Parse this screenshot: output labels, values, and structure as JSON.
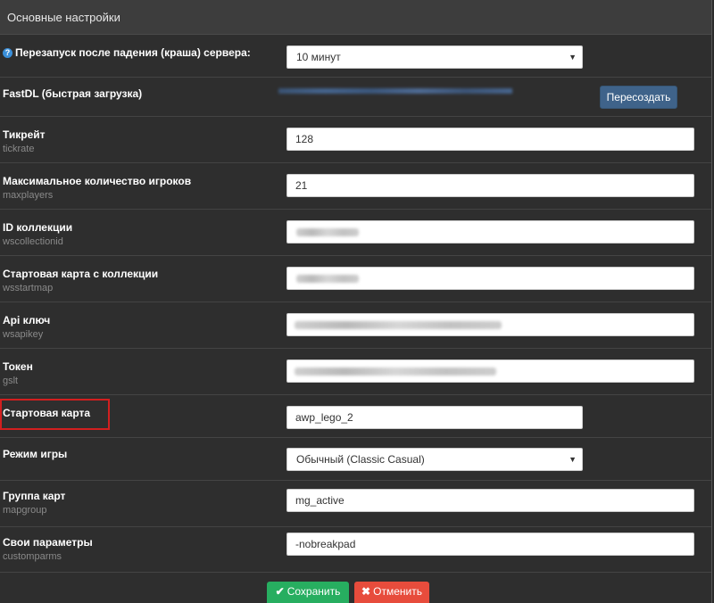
{
  "panel": {
    "title": "Основные настройки"
  },
  "settings": {
    "restart": {
      "label": "Перезапуск после падения (краша) сервера:",
      "value": "10 минут"
    },
    "fastdl": {
      "label": "FastDL (быстрая загрузка)",
      "button": "Пересоздать"
    },
    "tickrate": {
      "label": "Тикрейт",
      "sub": "tickrate",
      "value": "128"
    },
    "maxplayers": {
      "label": "Максимальное количество игроков",
      "sub": "maxplayers",
      "value": "21"
    },
    "collection": {
      "label": "ID коллекции",
      "sub": "wscollectionid"
    },
    "startmap_ws": {
      "label": "Стартовая карта с коллекции",
      "sub": "wsstartmap"
    },
    "apikey": {
      "label": "Api ключ",
      "sub": "wsapikey"
    },
    "token": {
      "label": "Токен",
      "sub": "gslt"
    },
    "startmap": {
      "label": "Стартовая карта",
      "value": "awp_lego_2"
    },
    "gamemode": {
      "label": "Режим игры",
      "value": "Обычный (Classic Casual)"
    },
    "mapgroup": {
      "label": "Группа карт",
      "sub": "mapgroup",
      "value": "mg_active"
    },
    "customparms": {
      "label": "Свои параметры",
      "sub": "customparms",
      "value": "-nobreakpad"
    }
  },
  "actions": {
    "save": "Сохранить",
    "cancel": "Отменить"
  },
  "icons": {
    "help": "question-circle-icon",
    "caret": "caret-down-icon",
    "save": "check-icon",
    "cancel": "times-icon"
  },
  "colors": {
    "save": "#27ae60",
    "cancel": "#e74c3c",
    "recreate": "#3f638a",
    "highlight": "#d21f1f"
  }
}
